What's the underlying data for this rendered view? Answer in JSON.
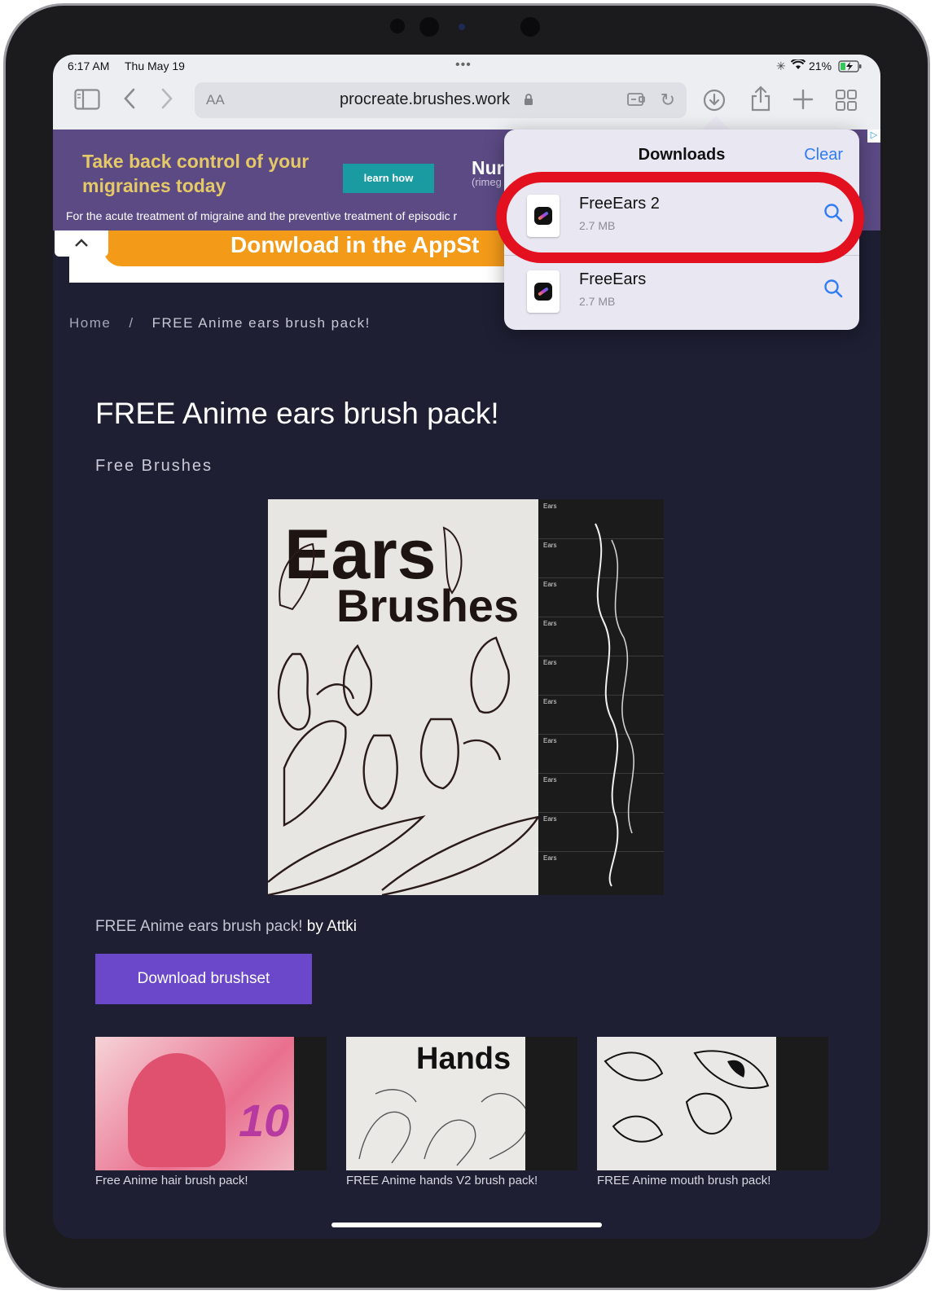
{
  "status_bar": {
    "time": "6:17 AM",
    "date": "Thu May 19",
    "battery": "21%"
  },
  "toolbar": {
    "aa_label": "AA",
    "url": "procreate.brushes.work",
    "icons": [
      "sidebar-icon",
      "back-icon",
      "forward-icon",
      "lock-icon",
      "extension-icon",
      "reload-icon",
      "downloads-icon",
      "share-icon",
      "new-tab-icon",
      "tabs-icon"
    ]
  },
  "ad": {
    "headline": "Take back control of your migraines today",
    "button": "learn how",
    "brand": "Nur",
    "brand_sub": "(rimeg",
    "disclaimer": "For the acute treatment of migraine and the preventive treatment of episodic r"
  },
  "app_banner": {
    "text": "Donwload in the AppSt"
  },
  "breadcrumb": {
    "home": "Home",
    "separator": "/",
    "current": "FREE Anime ears brush pack!"
  },
  "article": {
    "title": "FREE Anime ears brush pack!",
    "category": "Free Brushes",
    "hero_title_1": "Ears",
    "hero_title_2": "Brushes",
    "hero_strip_label": "Ears",
    "caption": "FREE Anime ears brush pack!",
    "caption_by": "by Attki",
    "download_button": "Download brushset"
  },
  "related": [
    {
      "label": "Free Anime hair brush pack!",
      "thumb_text": "10"
    },
    {
      "label": "FREE Anime hands V2 brush pack!",
      "thumb_text": "Hands"
    },
    {
      "label": "FREE Anime mouth brush pack!",
      "thumb_text": ""
    }
  ],
  "downloads": {
    "title": "Downloads",
    "clear": "Clear",
    "items": [
      {
        "name": "FreeEars 2",
        "size": "2.7 MB"
      },
      {
        "name": "FreeEars",
        "size": "2.7 MB"
      }
    ]
  },
  "colors": {
    "page_bg": "#1e1f33",
    "download_button": "#6a48c9",
    "ad_bg": "#5b4a84",
    "banner_orange": "#f39a19",
    "highlight_red": "#e3101f",
    "link_blue": "#2f7cf6"
  }
}
